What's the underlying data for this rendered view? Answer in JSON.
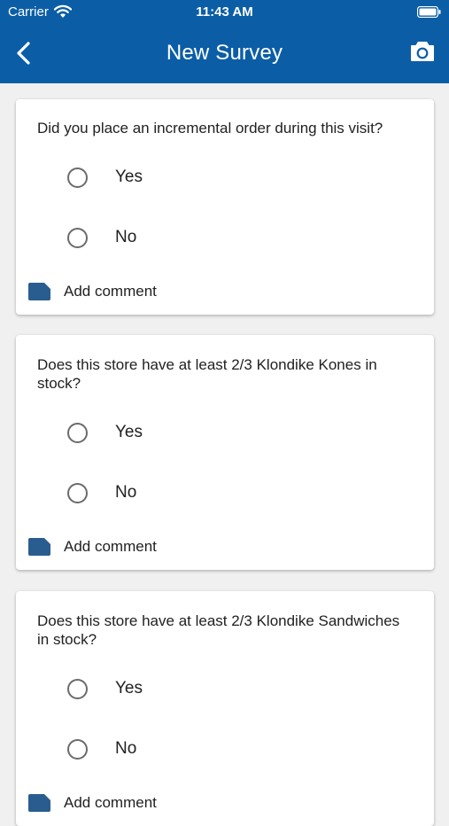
{
  "status_bar": {
    "carrier": "Carrier",
    "time": "11:43 AM"
  },
  "nav": {
    "title": "New Survey",
    "back_icon": "chevron-left-icon",
    "camera_icon": "camera-icon"
  },
  "colors": {
    "header": "#0b5ea6",
    "comment_icon": "#2a5d8f",
    "background": "#f0f0f0"
  },
  "questions": [
    {
      "text": "Did you place an incremental order during this visit?",
      "options": [
        "Yes",
        "No"
      ],
      "comment_label": "Add comment"
    },
    {
      "text": "Does this store have at least 2/3 Klondike Kones in stock?",
      "options": [
        "Yes",
        "No"
      ],
      "comment_label": "Add comment"
    },
    {
      "text": "Does this store have at least 2/3 Klondike Sandwiches in stock?",
      "options": [
        "Yes",
        "No"
      ],
      "comment_label": "Add comment"
    }
  ]
}
